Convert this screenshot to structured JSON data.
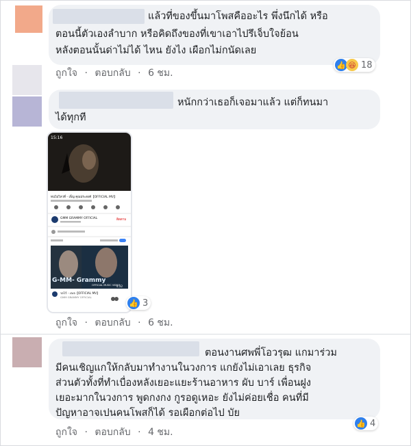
{
  "comments": [
    {
      "text_lines": [
        "แล้วที่ของขึ้นมาโพสคืออะไร พึ่งนึกได้ หรือ",
        "ตอนนี้ตัวเองลำบาก หรือคิดถึงของที่เขาเอาไปรึเจ็บใจย้อน",
        "หลังตอนนั้นด่าไม่ได้ ไหน ยังไง เผือกไม่กนัดเลย"
      ],
      "actions": {
        "like": "ถูกใจ",
        "reply": "ตอบกลับ",
        "time": "6 ชม."
      },
      "reaction_count": "18",
      "reactions": [
        "like-icon",
        "haha-icon"
      ],
      "avatar_color": "#f2a98a"
    },
    {
      "text_lines": [
        "หนักกว่าเธอก็เจอมาแล้ว แต่ก็ทนมา",
        "ได้ทุกที"
      ],
      "actions": {
        "like": "ถูกใจ",
        "reply": "ตอบกลับ",
        "time": "6 ชม."
      },
      "reaction_count": "3",
      "reactions": [
        "like-icon"
      ],
      "avatar_color": "#b7b5d6",
      "attachment": {
        "status_time": "15:16",
        "video_title": "ทนไม่ไหวที่ - เพ็ญ คุณประสงค์【OFFICIAL MV】",
        "channel": "GMM GRAMMY OFFICIAL",
        "subscribe": "ติดตาม",
        "next_title": "รอไว้ - เจเจ【OFFICIAL MV】",
        "next_channel": "GMM GRAMMY OFFICIAL",
        "banner": "OFFICIAL MUSIC VIDEO",
        "logo": "G-MM- Grammy",
        "duration": "4:32"
      }
    },
    {
      "text_lines": [
        "ตอนงานศพพี่โอวรุฒ แกมาร่วม",
        "มีคนเชิญแกให้กลับมาทำงานในวงการ แกยังไม่เอาเลย ธุรกิจ",
        "ส่วนตัวทั้งที่ทำเบื่องหลังเยอะแยะร้านอาหาร ผับ บาร์ เพื่อนฝูง",
        "เยอะมากในวงการ พูดกงกง กูรอดูเหอะ ยังไม่ค่อยเชื่อ คนที่มี",
        "ปัญหาอาจเปนคนโพสก็ได้ รอเผือกต่อไป บัย"
      ],
      "actions": {
        "like": "ถูกใจ",
        "reply": "ตอบกลับ",
        "time": "4 ชม."
      },
      "reaction_count": "4",
      "reactions": [
        "like-icon"
      ],
      "avatar_color": "#c9aeb1"
    }
  ]
}
